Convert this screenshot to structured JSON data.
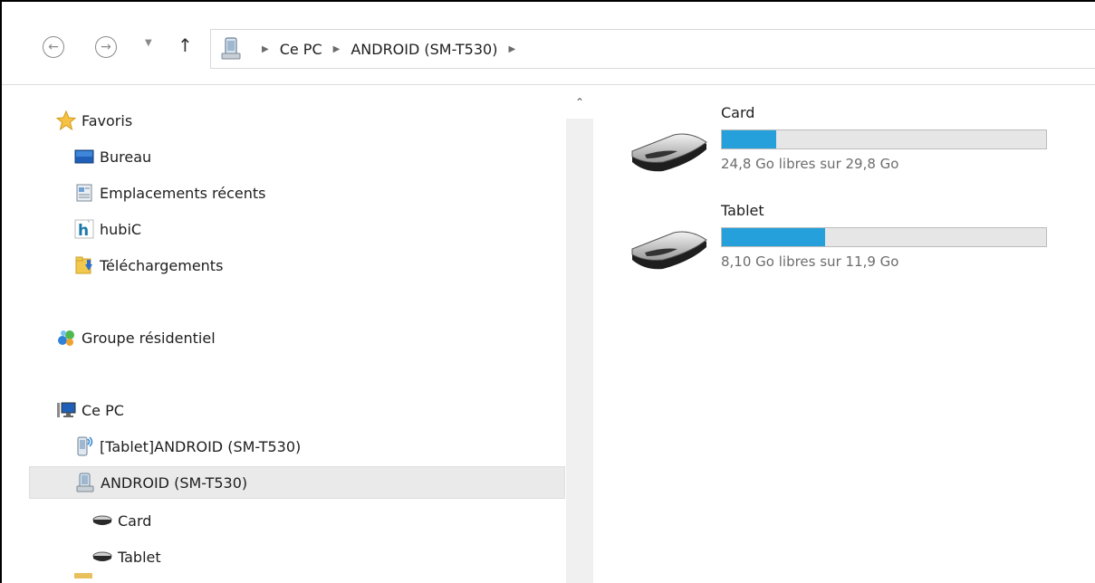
{
  "address": {
    "breadcrumbs": [
      "Ce PC",
      "ANDROID (SM-T530)"
    ]
  },
  "nav": {
    "favorites_label": "Favoris",
    "favorites": [
      {
        "label": "Bureau",
        "icon": "desktop-icon"
      },
      {
        "label": "Emplacements récents",
        "icon": "recent-places-icon"
      },
      {
        "label": "hubiC",
        "icon": "hubic-icon"
      },
      {
        "label": "Téléchargements",
        "icon": "downloads-icon"
      }
    ],
    "homegroup_label": "Groupe résidentiel",
    "thispc_label": "Ce PC",
    "devices": [
      {
        "label": "[Tablet]ANDROID (SM-T530)",
        "icon": "tablet-device-icon"
      },
      {
        "label": "ANDROID (SM-T530)",
        "icon": "android-device-icon",
        "selected": true
      }
    ],
    "storages": [
      {
        "label": "Card",
        "icon": "drive-icon"
      },
      {
        "label": "Tablet",
        "icon": "drive-icon"
      }
    ]
  },
  "content": {
    "drives": [
      {
        "name": "Card",
        "space_text": "24,8 Go libres sur 29,8 Go",
        "used_fraction": 0.168
      },
      {
        "name": "Tablet",
        "space_text": "8,10 Go libres sur 11,9 Go",
        "used_fraction": 0.319
      }
    ]
  },
  "colors": {
    "accent": "#26a0da",
    "selection_bg": "#eaeaea"
  }
}
